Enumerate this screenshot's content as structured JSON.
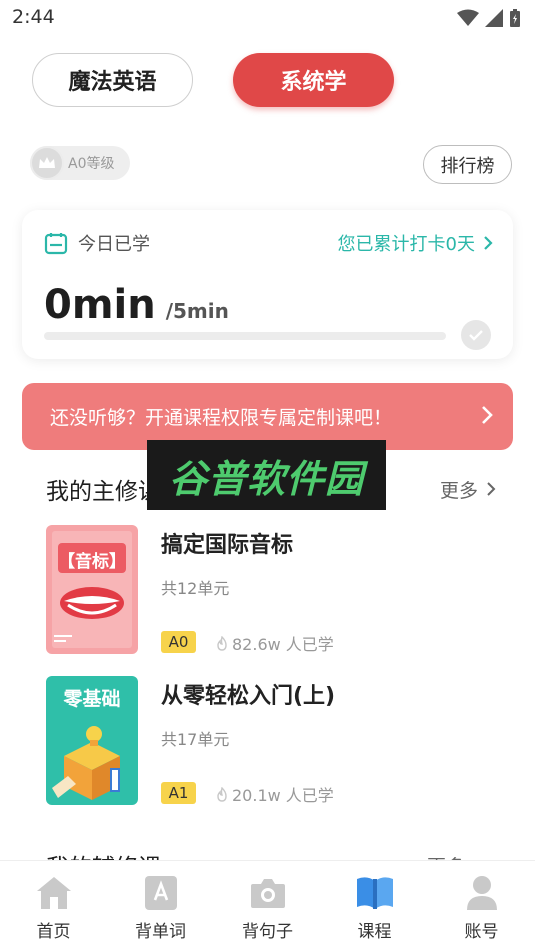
{
  "status_bar": {
    "time": "2:44"
  },
  "top_tabs": {
    "magic_english": "魔法英语",
    "system_learning": "系统学"
  },
  "level": {
    "label": "A0等级"
  },
  "rank_button": "排行榜",
  "today": {
    "title": "今日已学",
    "streak": "您已累计打卡0天",
    "value": "0min",
    "goal": "/5min",
    "progress": 0
  },
  "promo": {
    "text": "还没听够？开通课程权限专属定制课吧！"
  },
  "watermark": "谷普软件园",
  "main_courses": {
    "title": "我的主修课",
    "more": "更多",
    "items": [
      {
        "cover_text": "【音标】",
        "title": "搞定国际音标",
        "units": "共12单元",
        "level": "A0",
        "learners": "82.6w 人已学"
      },
      {
        "cover_text": "零基础",
        "title": "从零轻松入门(上)",
        "units": "共17单元",
        "level": "A1",
        "learners": "20.1w 人已学"
      }
    ]
  },
  "aux_courses": {
    "title": "我的辅修课",
    "more": "更多"
  },
  "bottom_nav": [
    {
      "label": "首页",
      "icon": "home-icon"
    },
    {
      "label": "背单词",
      "icon": "word-card-icon"
    },
    {
      "label": "背句子",
      "icon": "camera-icon"
    },
    {
      "label": "课程",
      "icon": "book-icon"
    },
    {
      "label": "账号",
      "icon": "user-icon"
    }
  ],
  "colors": {
    "accent": "#e04848",
    "teal": "#2bb7a9",
    "banner": "#ef7c7c",
    "active_nav": "#3a8ee6"
  }
}
